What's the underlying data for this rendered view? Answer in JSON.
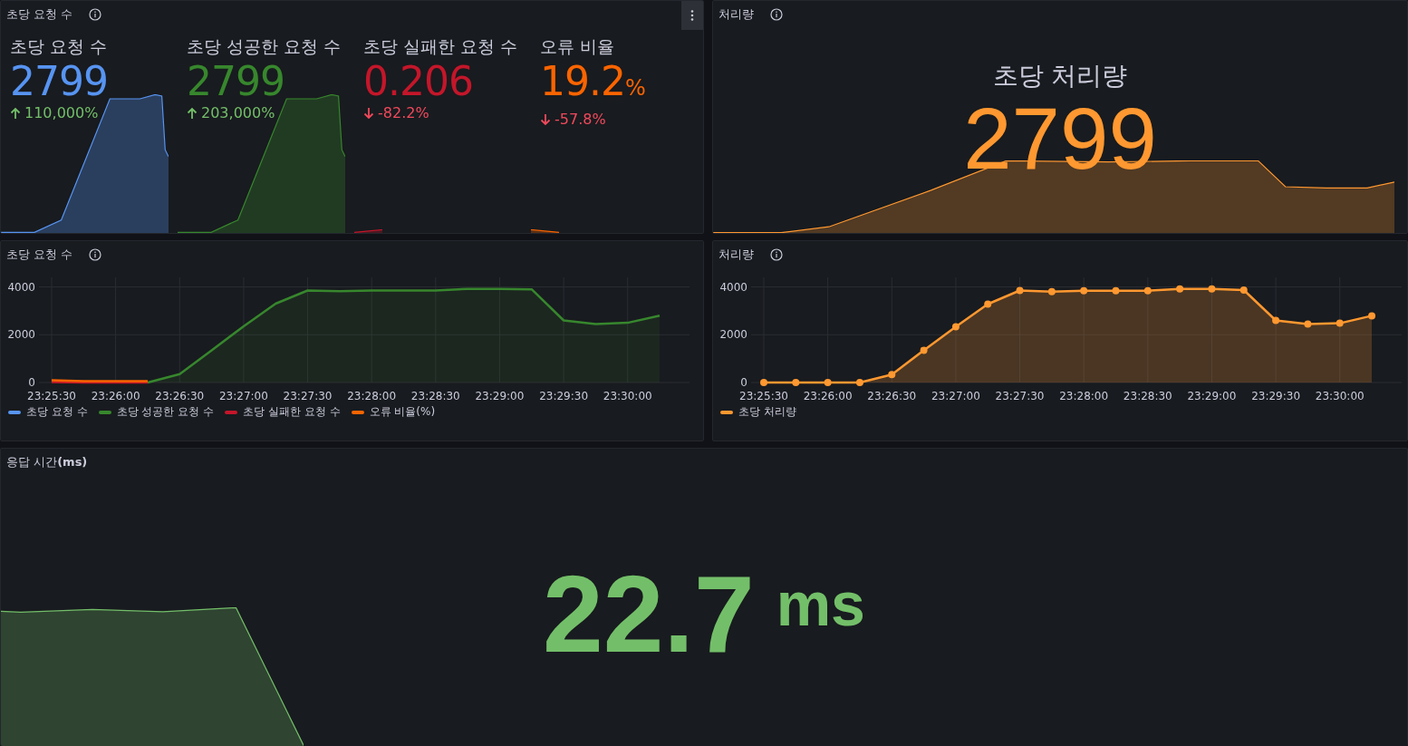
{
  "stat_panel": {
    "title": "초당 요청 수",
    "stats": [
      {
        "title": "초당 요청 수",
        "value": "2799",
        "color": "#5794f2",
        "delta": "110,000%",
        "kind": "up"
      },
      {
        "title": "초당 성공한 요청 수",
        "value": "2799",
        "color": "#37872d",
        "delta": "203,000%",
        "kind": "up"
      },
      {
        "title": "초당 실패한 요청 수",
        "value": "0.206",
        "color": "#c4162a",
        "delta": "-82.2%",
        "kind": "down"
      },
      {
        "title": "오류 비율",
        "value": "19.2",
        "unit": "%",
        "color": "#fa6400",
        "delta": "-57.8%",
        "kind": "down"
      }
    ]
  },
  "throughput_stat": {
    "title": "처리량",
    "stat_title": "초당 처리량",
    "value": "2799",
    "color": "#ff9830"
  },
  "requests_chart": {
    "title": "초당 요청 수",
    "chart_data": {
      "type": "area",
      "grid": true,
      "categories": [
        "23:25:30",
        null,
        "23:26:00",
        null,
        "23:26:30",
        null,
        "23:27:00",
        null,
        "23:27:30",
        null,
        "23:28:00",
        null,
        "23:28:30",
        null,
        "23:29:00",
        null,
        "23:29:30",
        null,
        "23:30:00",
        null
      ],
      "ylim": [
        0,
        4400
      ],
      "yticks": [
        0,
        2000,
        4000
      ],
      "series": [
        {
          "name": "초당 요청 수",
          "color": "#5794f2",
          "values": [
            null,
            null,
            null,
            null,
            null,
            null,
            null,
            null,
            null,
            null,
            null,
            null,
            null,
            null,
            null,
            null,
            null,
            null,
            null,
            null
          ]
        },
        {
          "name": "초당 성공한 요청 수",
          "color": "#37872d",
          "values": [
            null,
            null,
            null,
            0,
            350,
            1350,
            2350,
            3300,
            3850,
            3820,
            3850,
            3850,
            3850,
            3920,
            3920,
            3900,
            2600,
            2450,
            2500,
            2800
          ]
        },
        {
          "name": "초당 실패한 요청 수",
          "color": "#c4162a",
          "values": [
            20,
            0,
            0,
            0,
            null,
            null,
            null,
            null,
            null,
            null,
            null,
            null,
            null,
            null,
            null,
            null,
            null,
            null,
            null,
            null
          ]
        },
        {
          "name": "오류 비율(%)",
          "color": "#fa6400",
          "values": [
            100,
            60,
            60,
            60,
            null,
            null,
            null,
            null,
            null,
            null,
            null,
            null,
            null,
            null,
            null,
            null,
            null,
            null,
            null,
            null
          ]
        }
      ]
    }
  },
  "throughput_chart": {
    "title": "처리량",
    "chart_data": {
      "type": "line",
      "grid": true,
      "categories": [
        "23:25:30",
        null,
        "23:26:00",
        null,
        "23:26:30",
        null,
        "23:27:00",
        null,
        "23:27:30",
        null,
        "23:28:00",
        null,
        "23:28:30",
        null,
        "23:29:00",
        null,
        "23:29:30",
        null,
        "23:30:00",
        null
      ],
      "ylim": [
        0,
        4400
      ],
      "yticks": [
        0,
        2000,
        4000
      ],
      "series": [
        {
          "name": "초당 처리량",
          "color": "#ff9830",
          "marker": true,
          "values": [
            0,
            0,
            0,
            0,
            330,
            1350,
            2330,
            3280,
            3850,
            3800,
            3840,
            3840,
            3840,
            3920,
            3920,
            3870,
            2600,
            2450,
            2480,
            2790
          ]
        }
      ]
    }
  },
  "response_time": {
    "title": "응답 시간**(ms)**",
    "value": "22.7",
    "unit": "ms",
    "color": "#73bf69"
  }
}
